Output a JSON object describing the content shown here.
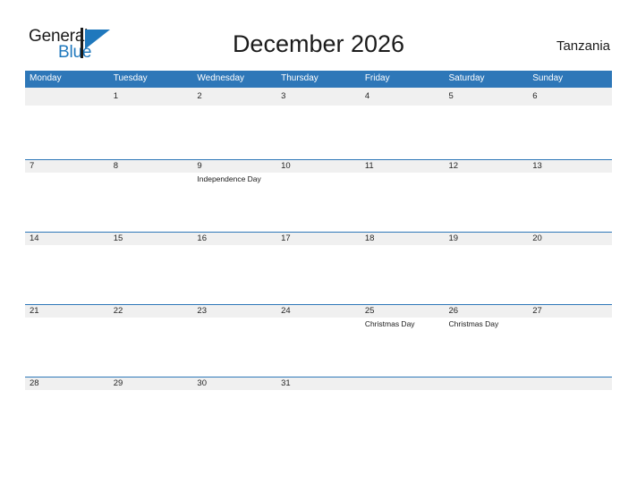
{
  "logo": {
    "text_primary": "General",
    "text_secondary": "Blue",
    "mark_name": "flag-triangle-icon",
    "color_primary": "#1b1b1b",
    "color_secondary": "#1f78bd"
  },
  "header": {
    "title": "December 2026",
    "country": "Tanzania"
  },
  "colors": {
    "header_blue": "#2e77b8",
    "date_band_gray": "#f0f0f0",
    "grid_line_blue": "#2e77b8",
    "text_dark": "#1b1b1b",
    "text_white": "#ffffff"
  },
  "calendar": {
    "month": "December",
    "year": "2026",
    "weekday_headers": [
      "Monday",
      "Tuesday",
      "Wednesday",
      "Thursday",
      "Friday",
      "Saturday",
      "Sunday"
    ],
    "weeks": [
      {
        "days": [
          {
            "num": "",
            "events": []
          },
          {
            "num": "1",
            "events": []
          },
          {
            "num": "2",
            "events": []
          },
          {
            "num": "3",
            "events": []
          },
          {
            "num": "4",
            "events": []
          },
          {
            "num": "5",
            "events": []
          },
          {
            "num": "6",
            "events": []
          }
        ]
      },
      {
        "days": [
          {
            "num": "7",
            "events": []
          },
          {
            "num": "8",
            "events": []
          },
          {
            "num": "9",
            "events": [
              "Independence Day"
            ]
          },
          {
            "num": "10",
            "events": []
          },
          {
            "num": "11",
            "events": []
          },
          {
            "num": "12",
            "events": []
          },
          {
            "num": "13",
            "events": []
          }
        ]
      },
      {
        "days": [
          {
            "num": "14",
            "events": []
          },
          {
            "num": "15",
            "events": []
          },
          {
            "num": "16",
            "events": []
          },
          {
            "num": "17",
            "events": []
          },
          {
            "num": "18",
            "events": []
          },
          {
            "num": "19",
            "events": []
          },
          {
            "num": "20",
            "events": []
          }
        ]
      },
      {
        "days": [
          {
            "num": "21",
            "events": []
          },
          {
            "num": "22",
            "events": []
          },
          {
            "num": "23",
            "events": []
          },
          {
            "num": "24",
            "events": []
          },
          {
            "num": "25",
            "events": [
              "Christmas Day"
            ]
          },
          {
            "num": "26",
            "events": [
              "Christmas Day"
            ]
          },
          {
            "num": "27",
            "events": []
          }
        ]
      },
      {
        "days": [
          {
            "num": "28",
            "events": []
          },
          {
            "num": "29",
            "events": []
          },
          {
            "num": "30",
            "events": []
          },
          {
            "num": "31",
            "events": []
          },
          {
            "num": "",
            "events": []
          },
          {
            "num": "",
            "events": []
          },
          {
            "num": "",
            "events": []
          }
        ]
      }
    ]
  }
}
